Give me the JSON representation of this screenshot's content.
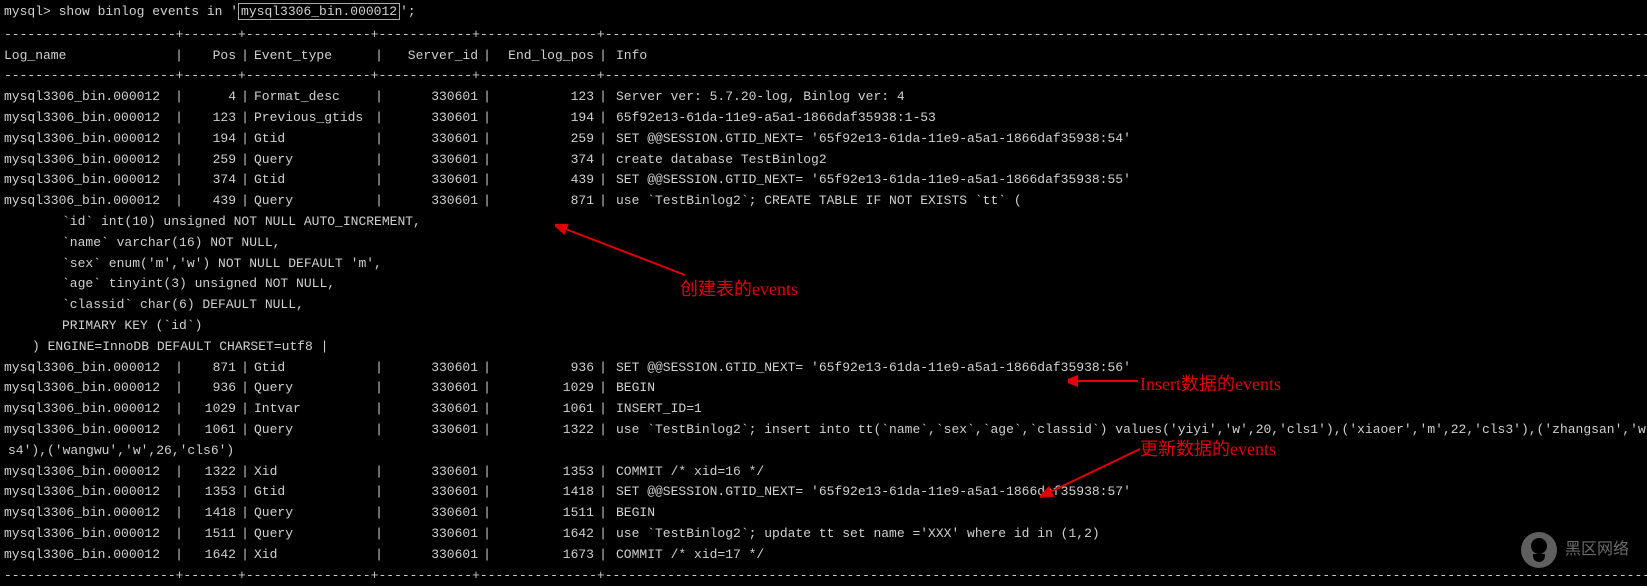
{
  "prompt": {
    "prefix": "mysql> ",
    "cmd_before": "show binlog events in '",
    "filename": "mysql3306_bin.000012",
    "cmd_after": "';"
  },
  "headers": {
    "log": "Log_name",
    "pos": "Pos",
    "evt": "Event_type",
    "srv": "Server_id",
    "end": "End_log_pos",
    "info": "Info"
  },
  "sep": "+----------------------+-------+----------------+------------+---------------+----------------------------------------------------------------------------------------------------------------------------------------------------------------------------------+",
  "sep2": "----------------------+-------+----------------+------------+---------------+----------------------------------------------------------------------------------------------------------------------------------------------------------------------------------+",
  "rows": [
    {
      "log": "mysql3306_bin.000012",
      "pos": "4",
      "evt": "Format_desc",
      "srv": "330601",
      "end": "123",
      "info": "Server ver: 5.7.20-log, Binlog ver: 4"
    },
    {
      "log": "mysql3306_bin.000012",
      "pos": "123",
      "evt": "Previous_gtids",
      "srv": "330601",
      "end": "194",
      "info": "65f92e13-61da-11e9-a5a1-1866daf35938:1-53"
    },
    {
      "log": "mysql3306_bin.000012",
      "pos": "194",
      "evt": "Gtid",
      "srv": "330601",
      "end": "259",
      "info": "SET @@SESSION.GTID_NEXT= '65f92e13-61da-11e9-a5a1-1866daf35938:54'"
    },
    {
      "log": "mysql3306_bin.000012",
      "pos": "259",
      "evt": "Query",
      "srv": "330601",
      "end": "374",
      "info": "create database TestBinlog2"
    },
    {
      "log": "mysql3306_bin.000012",
      "pos": "374",
      "evt": "Gtid",
      "srv": "330601",
      "end": "439",
      "info": "SET @@SESSION.GTID_NEXT= '65f92e13-61da-11e9-a5a1-1866daf35938:55'"
    },
    {
      "log": "mysql3306_bin.000012",
      "pos": "439",
      "evt": "Query",
      "srv": "330601",
      "end": "871",
      "info": "use `TestBinlog2`; CREATE TABLE IF NOT EXISTS `tt` ("
    }
  ],
  "ml": [
    "`id` int(10) unsigned NOT NULL AUTO_INCREMENT,",
    "`name` varchar(16) NOT NULL,",
    "`sex` enum('m','w') NOT NULL DEFAULT 'm',",
    "`age` tinyint(3) unsigned NOT NULL,",
    "`classid` char(6) DEFAULT NULL,",
    "PRIMARY KEY (`id`)"
  ],
  "ml_close": ") ENGINE=InnoDB DEFAULT CHARSET=utf8 |",
  "rows2": [
    {
      "log": "mysql3306_bin.000012",
      "pos": "871",
      "evt": "Gtid",
      "srv": "330601",
      "end": "936",
      "info": "SET @@SESSION.GTID_NEXT= '65f92e13-61da-11e9-a5a1-1866daf35938:56'"
    },
    {
      "log": "mysql3306_bin.000012",
      "pos": "936",
      "evt": "Query",
      "srv": "330601",
      "end": "1029",
      "info": "BEGIN"
    },
    {
      "log": "mysql3306_bin.000012",
      "pos": "1029",
      "evt": "Intvar",
      "srv": "330601",
      "end": "1061",
      "info": "INSERT_ID=1"
    },
    {
      "log": "mysql3306_bin.000012",
      "pos": "1061",
      "evt": "Query",
      "srv": "330601",
      "end": "1322",
      "info": "use `TestBinlog2`; insert into tt(`name`,`sex`,`age`,`classid`) values('yiyi','w',20,'cls1'),('xiaoer','m',22,'cls3'),('zhangsan','w"
    }
  ],
  "insert_cont": "s4'),('wangwu','w',26,'cls6')",
  "rows3": [
    {
      "log": "mysql3306_bin.000012",
      "pos": "1322",
      "evt": "Xid",
      "srv": "330601",
      "end": "1353",
      "info": "COMMIT /* xid=16 */"
    },
    {
      "log": "mysql3306_bin.000012",
      "pos": "1353",
      "evt": "Gtid",
      "srv": "330601",
      "end": "1418",
      "info": "SET @@SESSION.GTID_NEXT= '65f92e13-61da-11e9-a5a1-1866daf35938:57'"
    },
    {
      "log": "mysql3306_bin.000012",
      "pos": "1418",
      "evt": "Query",
      "srv": "330601",
      "end": "1511",
      "info": "BEGIN"
    },
    {
      "log": "mysql3306_bin.000012",
      "pos": "1511",
      "evt": "Query",
      "srv": "330601",
      "end": "1642",
      "info": "use `TestBinlog2`; update tt set name ='XXX' where id in (1,2)"
    },
    {
      "log": "mysql3306_bin.000012",
      "pos": "1642",
      "evt": "Xid",
      "srv": "330601",
      "end": "1673",
      "info": "COMMIT /* xid=17 */"
    }
  ],
  "annotations": {
    "a1": "创建表的events",
    "a2": "Insert数据的events",
    "a3": "更新数据的events"
  },
  "watermark": "黑区网络"
}
